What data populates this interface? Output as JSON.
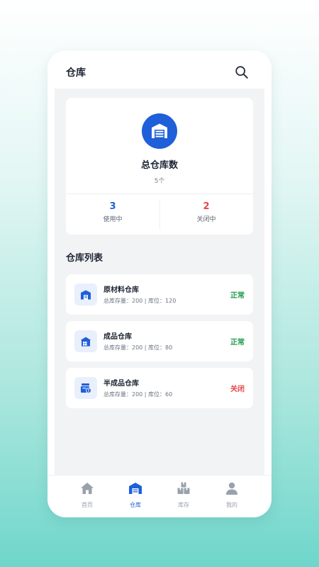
{
  "header": {
    "title": "仓库"
  },
  "summary": {
    "title": "总仓库数",
    "count": "5个",
    "using": {
      "value": "3",
      "label": "使用中"
    },
    "closed": {
      "value": "2",
      "label": "关闭中"
    }
  },
  "list": {
    "title": "仓库列表",
    "items": [
      {
        "name": "原材料仓库",
        "detail": "总库存量：200 | 库位：120",
        "status": "正常"
      },
      {
        "name": "成品仓库",
        "detail": "总库存量：200 | 库位：80",
        "status": "正常"
      },
      {
        "name": "半成品仓库",
        "detail": "总库存量：200 | 库位：60",
        "status": "关闭"
      }
    ]
  },
  "tabs": [
    {
      "label": "首页",
      "icon": "home-icon"
    },
    {
      "label": "仓库",
      "icon": "warehouse-icon",
      "active": true
    },
    {
      "label": "库存",
      "icon": "boxes-icon"
    },
    {
      "label": "我的",
      "icon": "user-icon"
    }
  ],
  "colors": {
    "primary": "#1f5fd9",
    "ok": "#1f9d4c",
    "off": "#e5484d"
  }
}
